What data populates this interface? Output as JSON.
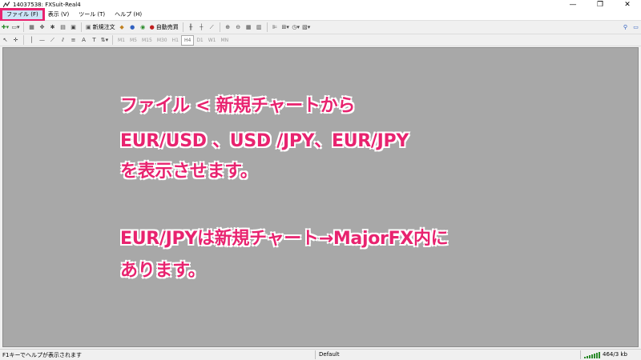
{
  "window": {
    "title": "14037538: FXSuit-Real4"
  },
  "menu": [
    {
      "label": "ファイル (F)",
      "active": true
    },
    {
      "label": "表示 (V)"
    },
    {
      "label": "ツール (T)"
    },
    {
      "label": "ヘルプ (H)"
    }
  ],
  "toolbar": {
    "new_order_label": "新規注文",
    "auto_trade_label": "自動売買"
  },
  "timeframes": [
    "M1",
    "M5",
    "M15",
    "M30",
    "H1",
    "H4",
    "D1",
    "W1",
    "MN"
  ],
  "annotation": {
    "line1": "ファイル < 新規チャートから",
    "line2": "EUR/USD 、USD /JPY、EUR/JPY",
    "line3": "を表示させます。",
    "line4": "EUR/JPYは新規チャート→MajorFX内に",
    "line5": "あります。"
  },
  "status": {
    "help": "F1キーでヘルプが表示されます",
    "profile": "Default",
    "traffic": "464/3 kb"
  },
  "colors": {
    "annotation": "#e8236f",
    "highlight": "#e8236f",
    "workspace": "#a8a8a8"
  }
}
